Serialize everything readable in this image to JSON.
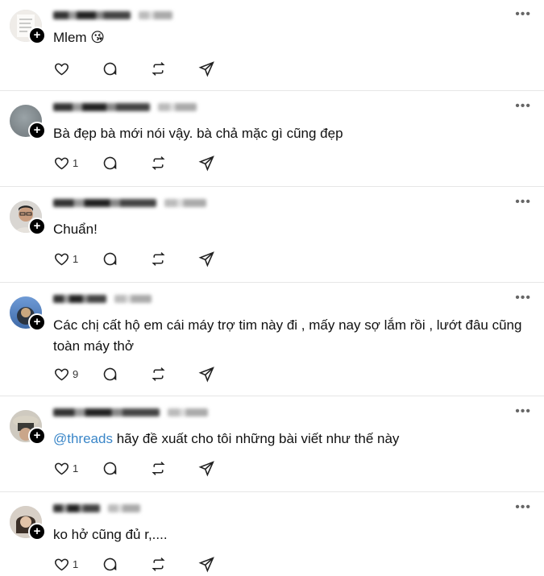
{
  "posts": [
    {
      "text": "Mlem 😘",
      "likes": "",
      "avatar_color": "#e9e6e2",
      "avatar_kind": "note"
    },
    {
      "text": "Bà đẹp bà mới nói vậy. bà chả mặc gì cũng đẹp",
      "likes": "1",
      "avatar_color": "#8d959a",
      "avatar_kind": "dark"
    },
    {
      "text": "Chuẩn!",
      "likes": "1",
      "avatar_color": "#c89c7e",
      "avatar_kind": "face"
    },
    {
      "text": "Các chị cất hộ em cái máy trợ tim này đi , mấy nay sợ lắm rồi , lướt đâu cũng toàn máy thở",
      "likes": "9",
      "avatar_color": "#5a86c2",
      "avatar_kind": "dark"
    },
    {
      "mention": "@threads",
      "text": " hãy đề xuất cho tôi những bài viết như thế này",
      "likes": "1",
      "avatar_color": "#b7b6ae",
      "avatar_kind": "hat"
    },
    {
      "text": "ko hở cũng đủ r,....",
      "likes": "1",
      "avatar_color": "#a9907a",
      "avatar_kind": "face"
    }
  ],
  "ui": {
    "more_label": "•••",
    "follow_plus": "+"
  }
}
